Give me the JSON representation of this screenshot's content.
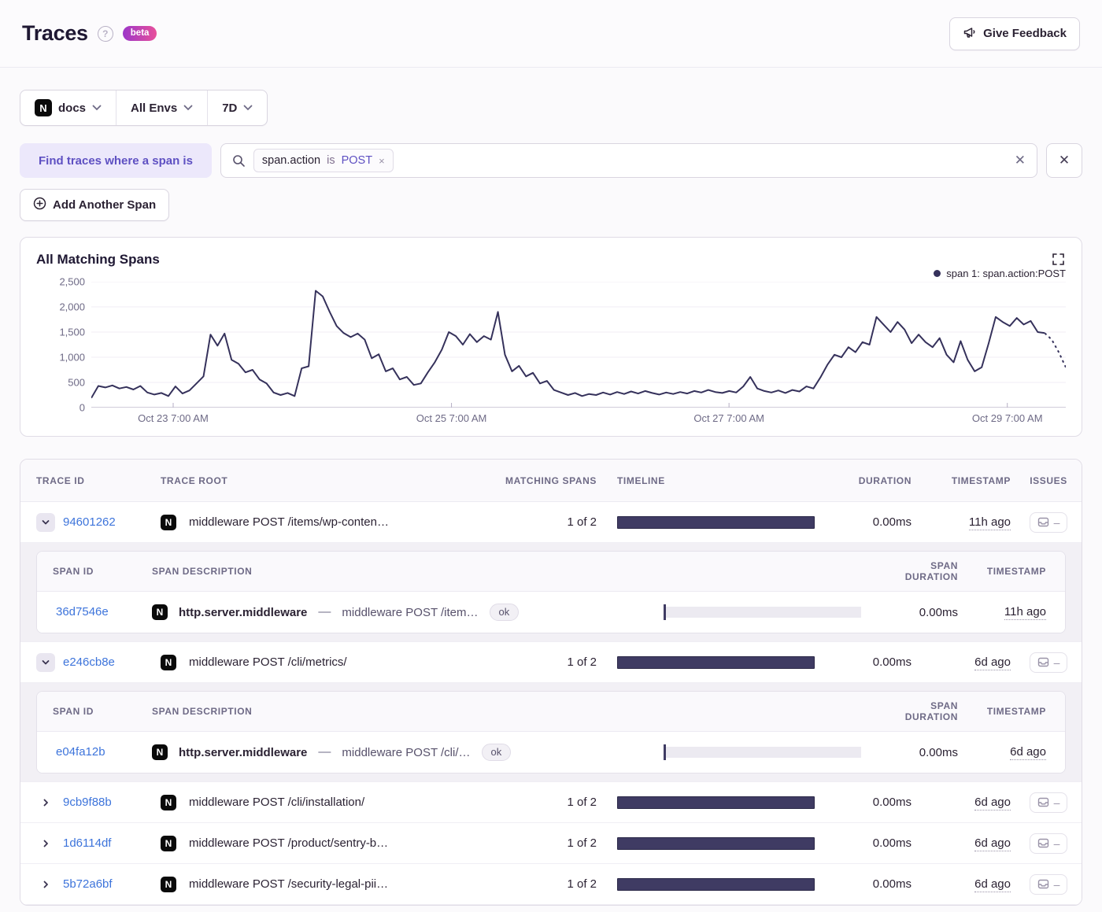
{
  "header": {
    "title": "Traces",
    "help_icon": "?",
    "beta_label": "beta",
    "feedback_label": "Give Feedback"
  },
  "filters": {
    "project": "docs",
    "project_platform": "N",
    "env": "All Envs",
    "period": "7D"
  },
  "search": {
    "prefix_label": "Find traces where a span is",
    "token": {
      "key": "span.action",
      "op": "is",
      "value": "POST",
      "remove_icon": "×"
    },
    "clear_icon": "✕",
    "close_icon": "✕",
    "add_span_label": "Add Another Span"
  },
  "chart": {
    "title": "All Matching Spans",
    "legend": "span 1: span.action:POST"
  },
  "chart_data": {
    "type": "line",
    "title": "All Matching Spans",
    "series_name": "span 1: span.action:POST",
    "ylim": [
      0,
      2500
    ],
    "y_ticks": [
      "2,500",
      "2,000",
      "1,500",
      "1,000",
      "500",
      "0"
    ],
    "x_tick_labels": [
      "Oct 23 7:00 AM",
      "Oct 25 7:00 AM",
      "Oct 27 7:00 AM",
      "Oct 29 7:00 AM"
    ],
    "x_tick_fractions": [
      0.084,
      0.3696,
      0.6544,
      0.94
    ],
    "grid": true,
    "legend_position": "top-right",
    "line_color": "#35315B",
    "dashed_tail_points": 4,
    "values": [
      190,
      430,
      400,
      440,
      380,
      410,
      360,
      430,
      300,
      260,
      290,
      230,
      420,
      280,
      340,
      480,
      620,
      1450,
      1230,
      1470,
      950,
      870,
      700,
      750,
      560,
      480,
      300,
      250,
      290,
      230,
      780,
      820,
      2320,
      2210,
      1900,
      1620,
      1480,
      1400,
      1470,
      1350,
      980,
      1060,
      720,
      780,
      560,
      610,
      450,
      480,
      700,
      900,
      1150,
      1500,
      1420,
      1250,
      1460,
      1300,
      1420,
      1350,
      1900,
      1050,
      720,
      830,
      620,
      690,
      480,
      530,
      350,
      300,
      250,
      290,
      230,
      270,
      250,
      300,
      260,
      310,
      270,
      320,
      280,
      330,
      290,
      260,
      300,
      270,
      310,
      280,
      330,
      300,
      350,
      310,
      290,
      330,
      300,
      420,
      610,
      380,
      330,
      300,
      340,
      290,
      350,
      320,
      420,
      380,
      600,
      850,
      1050,
      1000,
      1200,
      1100,
      1300,
      1250,
      1800,
      1650,
      1500,
      1700,
      1550,
      1280,
      1450,
      1300,
      1200,
      1380,
      1050,
      900,
      1320,
      950,
      720,
      800,
      1280,
      1800,
      1700,
      1620,
      1780,
      1650,
      1720,
      1500,
      1480,
      1350,
      1100,
      800
    ]
  },
  "table": {
    "columns": {
      "trace_id": "Trace ID",
      "trace_root": "Trace Root",
      "matching_spans": "Matching Spans",
      "timeline": "Timeline",
      "duration": "Duration",
      "timestamp": "Timestamp",
      "issues": "Issues"
    },
    "span_columns": {
      "span_id": "Span ID",
      "span_description": "Span Description",
      "span_duration": "Span Duration",
      "timestamp": "Timestamp"
    },
    "rows": [
      {
        "id": "94601262",
        "expanded": true,
        "platform": "N",
        "root": "middleware POST /items/wp-conten…",
        "matching": "1 of 2",
        "duration": "0.00ms",
        "timestamp": "11h ago",
        "spans": [
          {
            "id": "36d7546e",
            "platform": "N",
            "op": "http.server.middleware",
            "desc": "middleware POST /item…",
            "status": "ok",
            "duration": "0.00ms",
            "timestamp": "11h ago"
          }
        ]
      },
      {
        "id": "e246cb8e",
        "expanded": true,
        "platform": "N",
        "root": "middleware POST /cli/metrics/",
        "matching": "1 of 2",
        "duration": "0.00ms",
        "timestamp": "6d ago",
        "spans": [
          {
            "id": "e04fa12b",
            "platform": "N",
            "op": "http.server.middleware",
            "desc": "middleware POST /cli/…",
            "status": "ok",
            "duration": "0.00ms",
            "timestamp": "6d ago"
          }
        ]
      },
      {
        "id": "9cb9f88b",
        "expanded": false,
        "platform": "N",
        "root": "middleware POST /cli/installation/",
        "matching": "1 of 2",
        "duration": "0.00ms",
        "timestamp": "6d ago",
        "spans": []
      },
      {
        "id": "1d6114df",
        "expanded": false,
        "platform": "N",
        "root": "middleware POST /product/sentry-b…",
        "matching": "1 of 2",
        "duration": "0.00ms",
        "timestamp": "6d ago",
        "spans": []
      },
      {
        "id": "5b72a6bf",
        "expanded": false,
        "platform": "N",
        "root": "middleware POST /security-legal-pii…",
        "matching": "1 of 2",
        "duration": "0.00ms",
        "timestamp": "6d ago",
        "spans": []
      }
    ]
  },
  "colors": {
    "accent_purple": "#5E50C2",
    "link_blue": "#3D74DB",
    "line_navy": "#35315B",
    "bar_navy": "#3F3B63",
    "beta_gradient_from": "#9C36C9",
    "beta_gradient_to": "#E8509B"
  }
}
